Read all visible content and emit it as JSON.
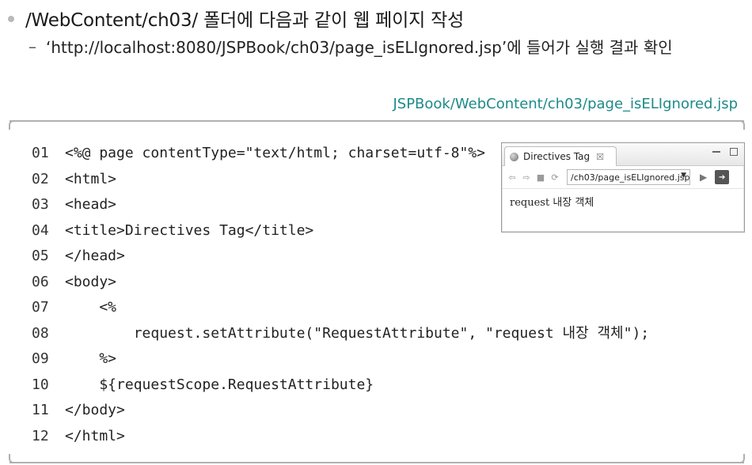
{
  "heading": {
    "text": "/WebContent/ch03/ 폴더에 다음과 같이 웹 페이지 작성"
  },
  "subline": {
    "dash": "–",
    "text": "‘http://localhost:8080/JSPBook/ch03/page_isELIgnored.jsp’에 들어가 실행 결과 확인"
  },
  "file_path": "JSPBook/WebContent/ch03/page_isELIgnored.jsp",
  "code": {
    "lines": [
      {
        "num": "01",
        "text": "<%@ page contentType=\"text/html; charset=utf-8\"%>"
      },
      {
        "num": "02",
        "text": "<html>"
      },
      {
        "num": "03",
        "text": "<head>"
      },
      {
        "num": "04",
        "text": "<title>Directives Tag</title>"
      },
      {
        "num": "05",
        "text": "</head>"
      },
      {
        "num": "06",
        "text": "<body>"
      },
      {
        "num": "07",
        "text": "    <%"
      },
      {
        "num": "08",
        "text": "        request.setAttribute(\"RequestAttribute\", \"request 내장 객체\");"
      },
      {
        "num": "09",
        "text": "    %>"
      },
      {
        "num": "10",
        "text": "    ${requestScope.RequestAttribute}"
      },
      {
        "num": "11",
        "text": "</body>"
      },
      {
        "num": "12",
        "text": "</html>"
      }
    ]
  },
  "browser": {
    "tab_title": "Directives Tag",
    "tab_close": "☒",
    "url": "/ch03/page_isELIgnored.jsp",
    "content_word": "request",
    "content_rest": " 내장 객체"
  },
  "colors": {
    "path_label": "#1d8a8a",
    "bullet": "#b9b9b9",
    "box_border": "#b0b0b0"
  },
  "icons": [
    "back-icon",
    "forward-icon",
    "stop-icon",
    "refresh-icon",
    "go-icon",
    "external-browser-icon",
    "globe-icon",
    "minimize-icon",
    "maximize-icon"
  ]
}
